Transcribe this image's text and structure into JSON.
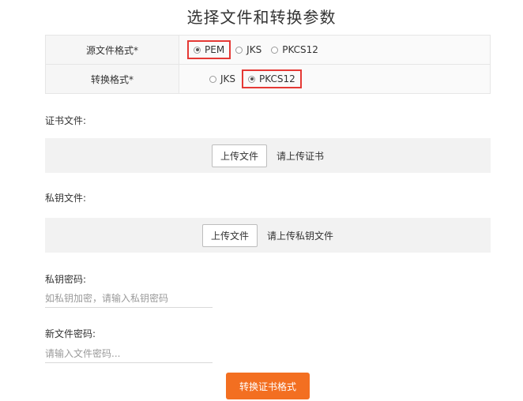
{
  "page_title": "选择文件和转换参数",
  "source_format": {
    "label": "源文件格式*",
    "options": [
      "PEM",
      "JKS",
      "PKCS12"
    ],
    "selected": "PEM"
  },
  "target_format": {
    "label": "转换格式*",
    "options": [
      "JKS",
      "PKCS12"
    ],
    "selected": "PKCS12"
  },
  "certificate": {
    "label": "证书文件:",
    "button": "上传文件",
    "hint": "请上传证书"
  },
  "private_key": {
    "label": "私钥文件:",
    "button": "上传文件",
    "hint": "请上传私钥文件"
  },
  "key_password": {
    "label": "私钥密码:",
    "placeholder": "如私钥加密，请输入私钥密码",
    "value": ""
  },
  "new_password": {
    "label": "新文件密码:",
    "placeholder": "请输入文件密码...",
    "value": ""
  },
  "convert_button": "转换证书格式",
  "colors": {
    "accent": "#f36f21",
    "highlight_border": "#e53935"
  }
}
